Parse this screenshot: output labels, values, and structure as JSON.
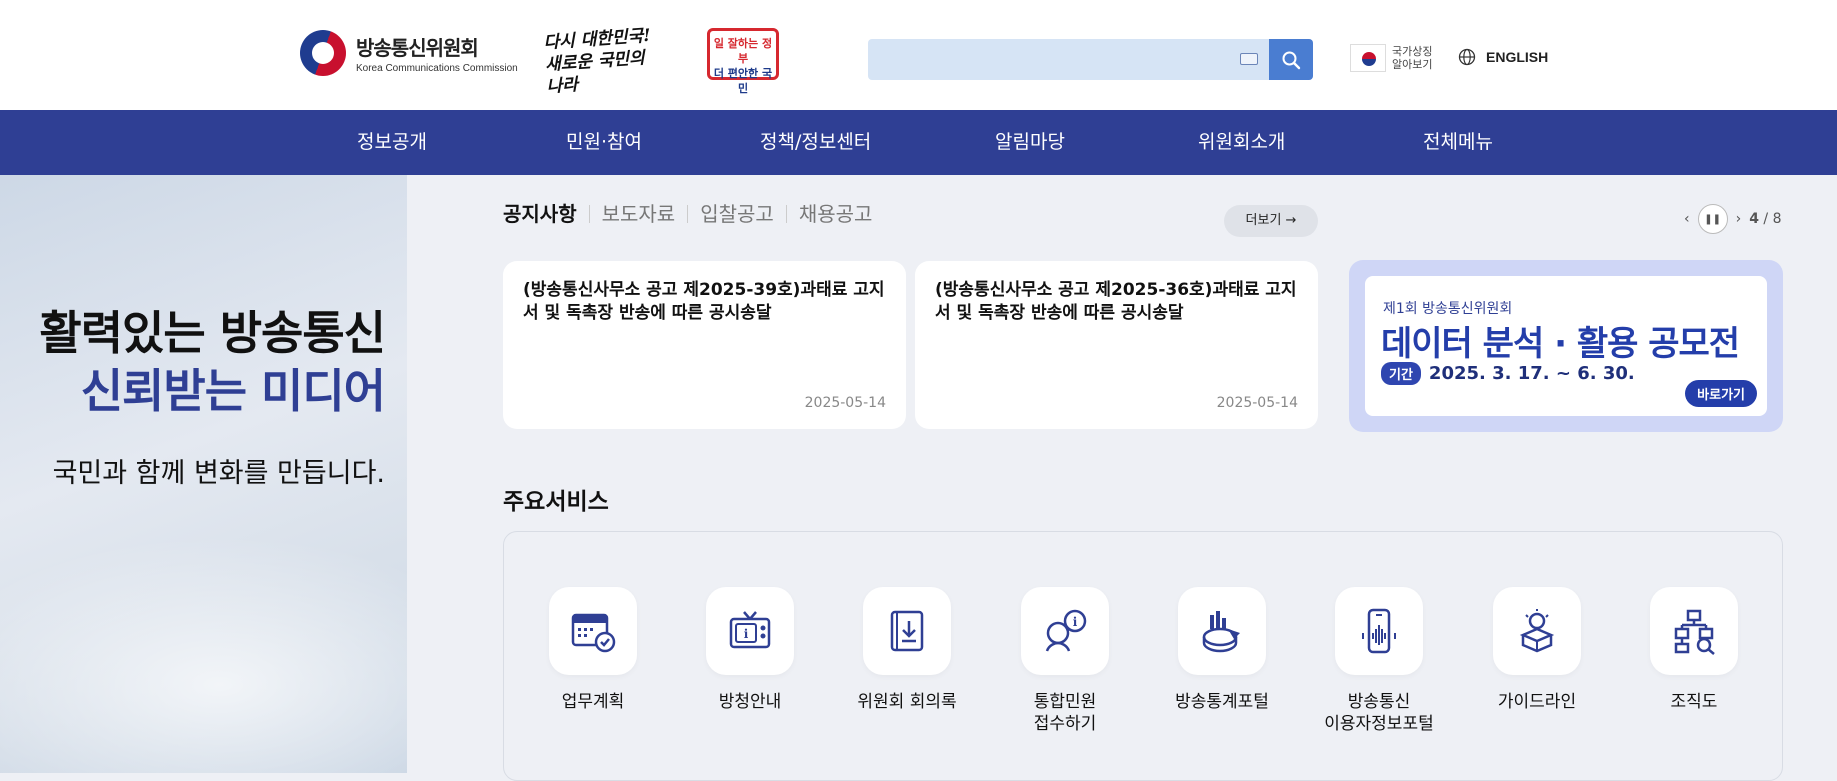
{
  "header": {
    "logo_ko": "방송통신위원회",
    "logo_en": "Korea Communications Commission",
    "slogan1_line1": "다시 대한민국!",
    "slogan1_line2": "새로운 국민의 나라",
    "slogan2_line1": "일 잘하는 정부",
    "slogan2_line2": "더 편안한 국민",
    "search_placeholder": "",
    "flag_line1": "국가상징",
    "flag_line2": "알아보기",
    "english": "ENGLISH"
  },
  "nav": [
    "정보공개",
    "민원·참여",
    "정책/정보센터",
    "알림마당",
    "위원회소개",
    "전체메뉴"
  ],
  "hero": {
    "line1": "활력있는 방송통신",
    "line2": "신뢰받는 미디어",
    "line3": "국민과 함께 변화를 만듭니다."
  },
  "notice": {
    "tabs": [
      "공지사항",
      "보도자료",
      "입찰공고",
      "채용공고"
    ],
    "more": "더보기 →",
    "page_current": "4",
    "page_total": "/ 8",
    "cards": [
      {
        "title": "(방송통신사무소 공고 제2025-39호)과태료 고지서 및 독촉장 반송에 따른 공시송달",
        "date": "2025-05-14"
      },
      {
        "title": "(방송통신사무소 공고 제2025-36호)과태료 고지서 및 독촉장 반송에 따른 공시송달",
        "date": "2025-05-14"
      }
    ]
  },
  "banner": {
    "top": "제1회 방송통신위원회",
    "main": "데이터 분석 · 활용 공모전",
    "period_label": "기간",
    "period": "2025. 3. 17. ~ 6. 30.",
    "go": "바로가기"
  },
  "services": {
    "title": "주요서비스",
    "items": [
      {
        "label": "업무계획",
        "icon": "calendar-check-icon"
      },
      {
        "label": "방청안내",
        "icon": "tv-info-icon"
      },
      {
        "label": "위원회 회의록",
        "icon": "book-download-icon"
      },
      {
        "label": "통합민원\n접수하기",
        "icon": "consult-icon"
      },
      {
        "label": "방송통계포털",
        "icon": "stats-pie-icon"
      },
      {
        "label": "방송통신\n이용자정보포털",
        "icon": "mobile-signal-icon"
      },
      {
        "label": "가이드라인",
        "icon": "bulb-box-icon"
      },
      {
        "label": "조직도",
        "icon": "org-chart-icon"
      }
    ]
  },
  "colors": {
    "nav_bg": "#2f3f94",
    "accent": "#4a7dd1",
    "hero_blue": "#2f3f94"
  }
}
